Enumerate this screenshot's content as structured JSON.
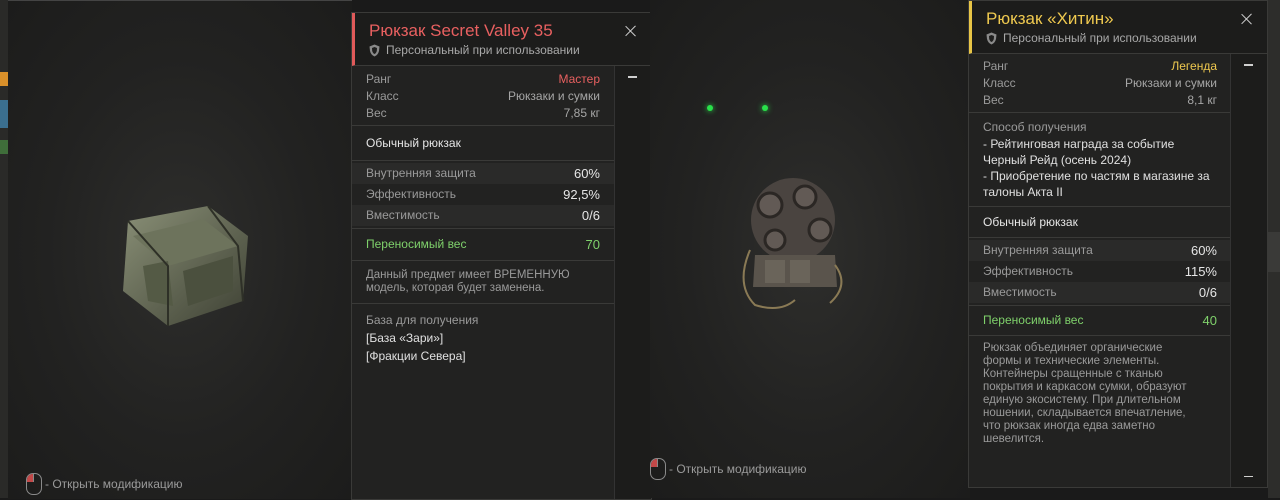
{
  "items": [
    {
      "title": "Рюкзак Secret Valley 35",
      "binding": "Персональный при использовании",
      "stats": [
        {
          "label": "Ранг",
          "value": "Мастер"
        },
        {
          "label": "Класс",
          "value": "Рюкзаки и сумки"
        },
        {
          "label": "Вес",
          "value": "7,85 кг"
        }
      ],
      "type": "Обычный рюкзак",
      "protection": [
        {
          "label": "Внутренняя защита",
          "value": "60%"
        },
        {
          "label": "Эффективность",
          "value": "92,5%"
        },
        {
          "label": "Вместимость",
          "value": "0/6"
        }
      ],
      "carry_label": "Переносимый вес",
      "carry_value": "70",
      "description": "Данный предмет имеет ВРЕМЕННУЮ модель, которая будет заменена.",
      "base_label": "База для получения",
      "bases": [
        "[База «Зари»]",
        "[Фракции Севера]"
      ],
      "mod_hint": "- Открыть модификацию"
    },
    {
      "title": "Рюкзак «Хитин»",
      "binding": "Персональный при использовании",
      "stats": [
        {
          "label": "Ранг",
          "value": "Легенда"
        },
        {
          "label": "Класс",
          "value": "Рюкзаки и сумки"
        },
        {
          "label": "Вес",
          "value": "8,1 кг"
        }
      ],
      "obtain_label": "Способ получения",
      "obtain_lines": [
        "- Рейтинговая награда за событие",
        "Черный Рейд (осень 2024)",
        "- Приобретение по частям в магазине за",
        "талоны Акта II"
      ],
      "type": "Обычный рюкзак",
      "protection": [
        {
          "label": "Внутренняя защита",
          "value": "60%"
        },
        {
          "label": "Эффективность",
          "value": "115%"
        },
        {
          "label": "Вместимость",
          "value": "0/6"
        }
      ],
      "carry_label": "Переносимый вес",
      "carry_value": "40",
      "description_lines": [
        "Рюкзак объединяет органические",
        "формы и технические элементы.",
        "Контейнеры сращенные с тканью",
        "покрытия и каркасом сумки, образуют",
        "единую экосистему. При длительном",
        "ношении, складывается впечатление,",
        "что рюкзак иногда едва заметно",
        "шевелится."
      ],
      "mod_hint": "- Открыть модификацию"
    }
  ],
  "colors": {
    "rank_master": "#e86060",
    "rank_legend": "#efc94f",
    "carry": "#7fd16b"
  }
}
